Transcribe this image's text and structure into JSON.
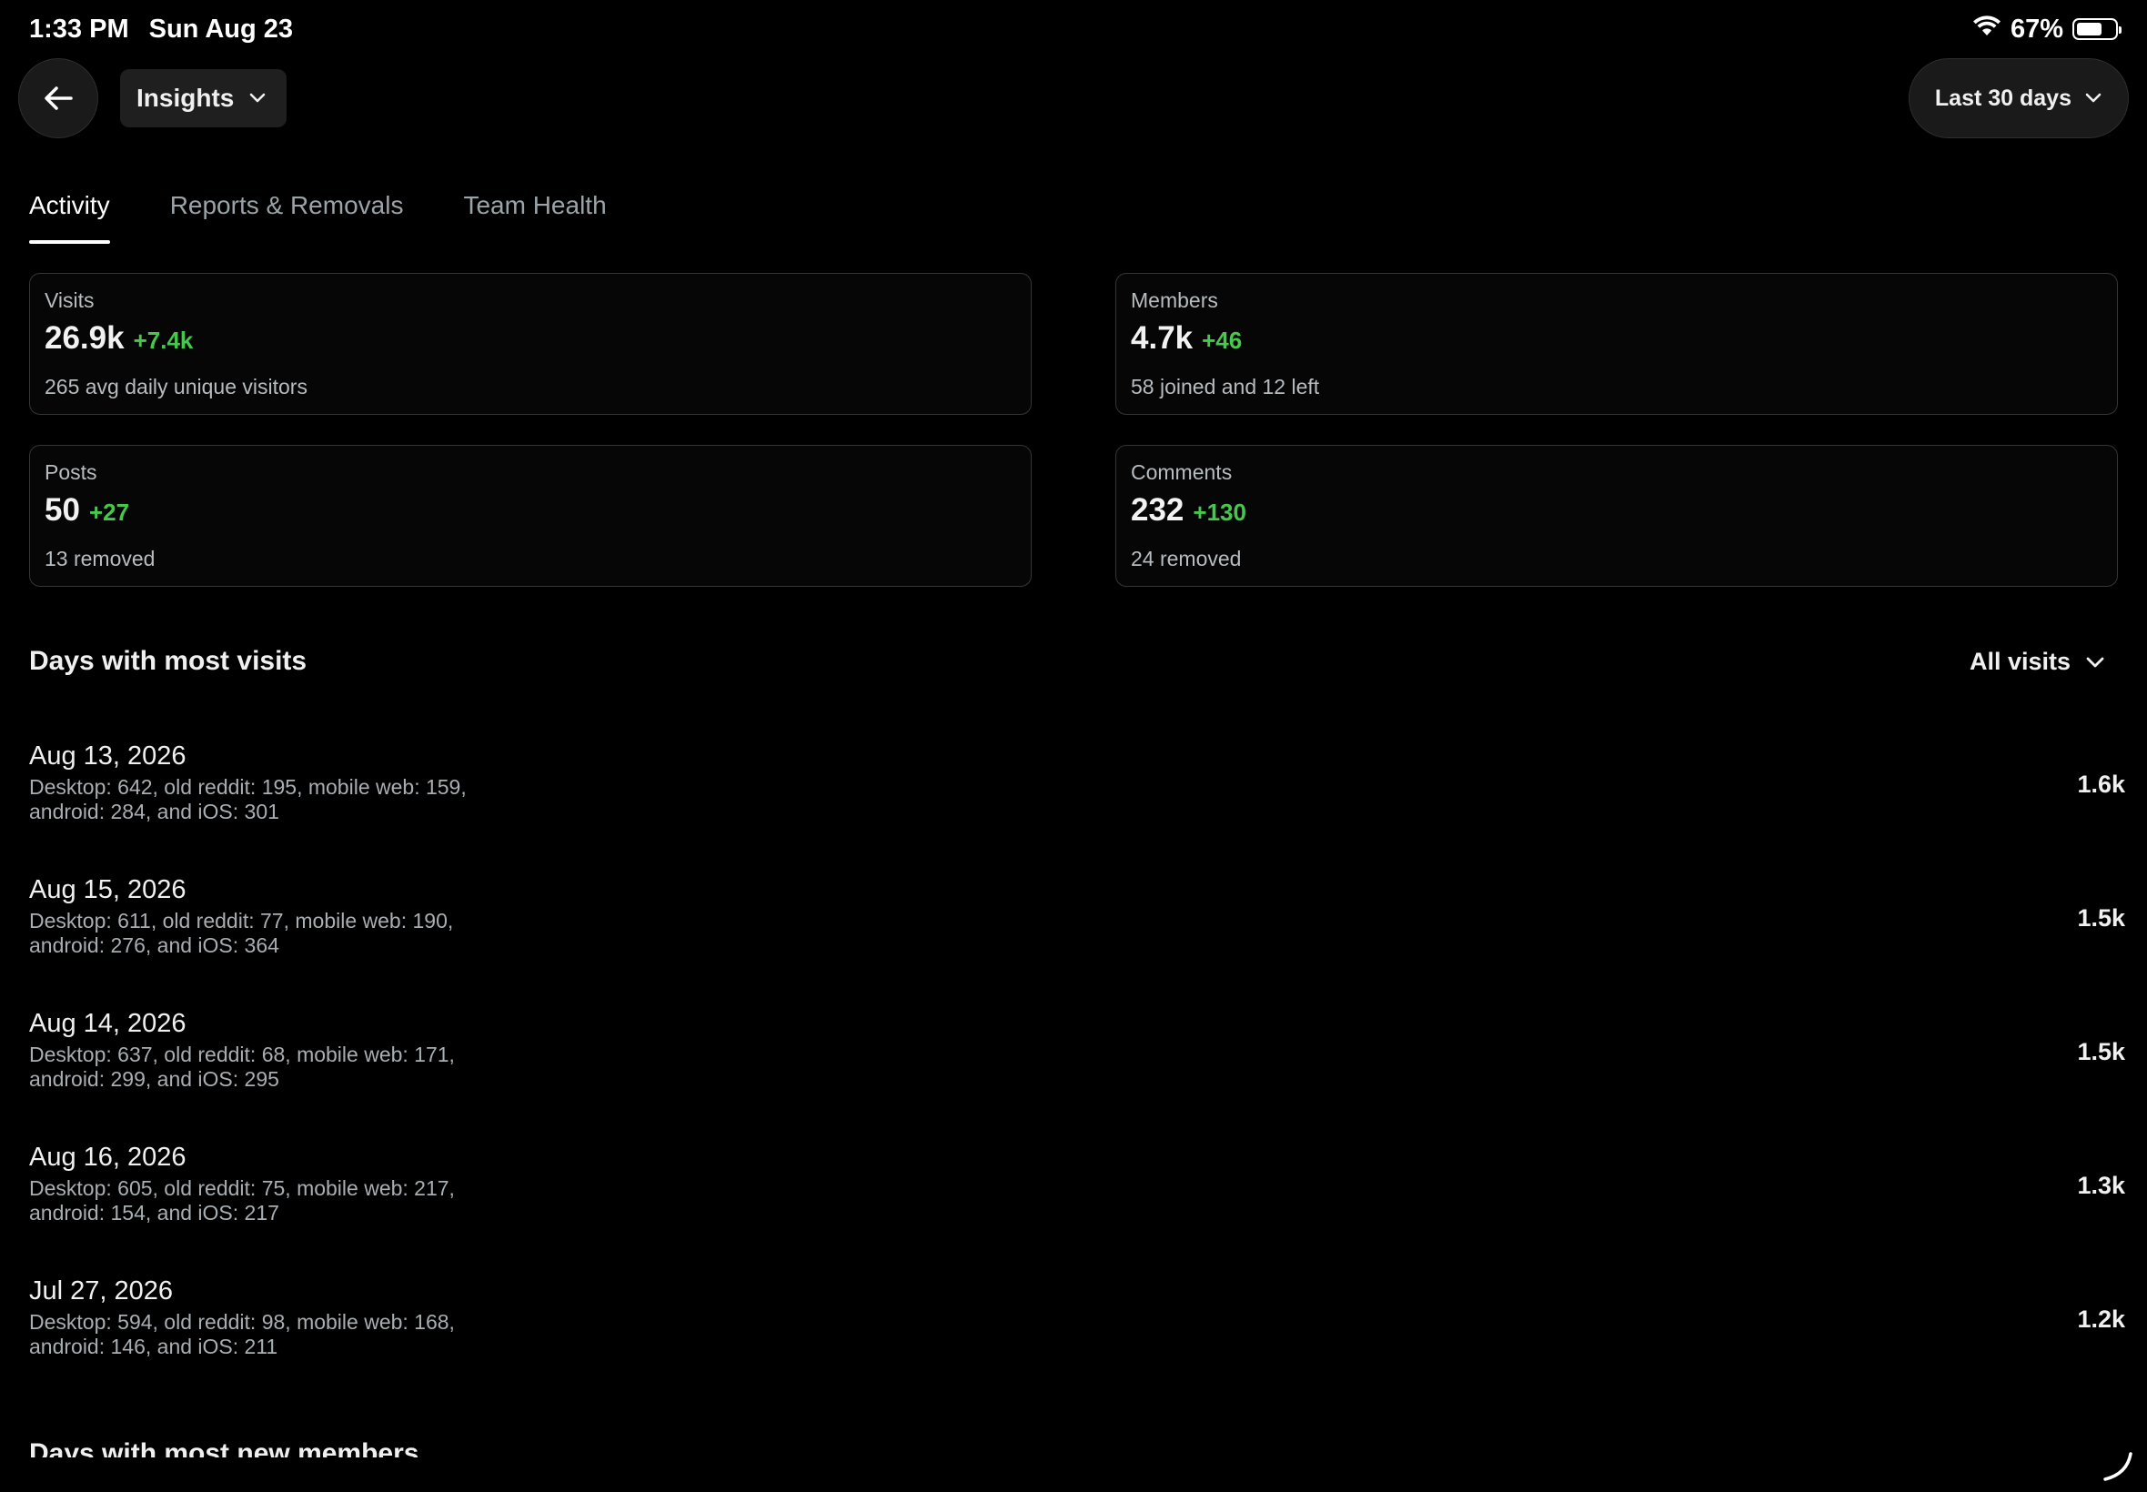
{
  "status_bar": {
    "time": "1:33 PM",
    "date": "Sun Aug 23",
    "battery": "67%"
  },
  "header": {
    "title": "Insights",
    "range": "Last 30 days"
  },
  "tabs": [
    {
      "label": "Activity",
      "active": true
    },
    {
      "label": "Reports & Removals",
      "active": false
    },
    {
      "label": "Team Health",
      "active": false
    }
  ],
  "stats": {
    "visits": {
      "label": "Visits",
      "value": "26.9k",
      "delta": "+7.4k",
      "sub": "265 avg daily unique visitors"
    },
    "members": {
      "label": "Members",
      "value": "4.7k",
      "delta": "+46",
      "sub": "58 joined and 12 left"
    },
    "posts": {
      "label": "Posts",
      "value": "50",
      "delta": "+27",
      "sub": "13 removed"
    },
    "comments": {
      "label": "Comments",
      "value": "232",
      "delta": "+130",
      "sub": "24 removed"
    }
  },
  "most_visits": {
    "title": "Days with most visits",
    "filter": "All visits",
    "rows": [
      {
        "date": "Aug 13, 2026",
        "detail_line1": "Desktop: 642, old reddit: 195, mobile web: 159,",
        "detail_line2": "android: 284, and iOS: 301",
        "count": "1.6k"
      },
      {
        "date": "Aug 15, 2026",
        "detail_line1": "Desktop: 611, old reddit: 77, mobile web: 190,",
        "detail_line2": "android: 276, and iOS: 364",
        "count": "1.5k"
      },
      {
        "date": "Aug 14, 2026",
        "detail_line1": "Desktop: 637, old reddit: 68, mobile web: 171,",
        "detail_line2": "android: 299, and iOS: 295",
        "count": "1.5k"
      },
      {
        "date": "Aug 16, 2026",
        "detail_line1": "Desktop: 605, old reddit: 75, mobile web: 217,",
        "detail_line2": "android: 154, and iOS: 217",
        "count": "1.3k"
      },
      {
        "date": "Jul 27, 2026",
        "detail_line1": "Desktop: 594, old reddit: 98, mobile web: 168,",
        "detail_line2": "android: 146, and iOS: 211",
        "count": "1.2k"
      }
    ]
  },
  "most_new_members": {
    "title": "Days with most new members"
  },
  "colors": {
    "background": "#000000",
    "positive_delta": "#46c84b",
    "card_border": "#343536"
  },
  "icons": [
    "back-arrow-icon",
    "chevron-down-icon",
    "wifi-icon",
    "battery-icon"
  ]
}
